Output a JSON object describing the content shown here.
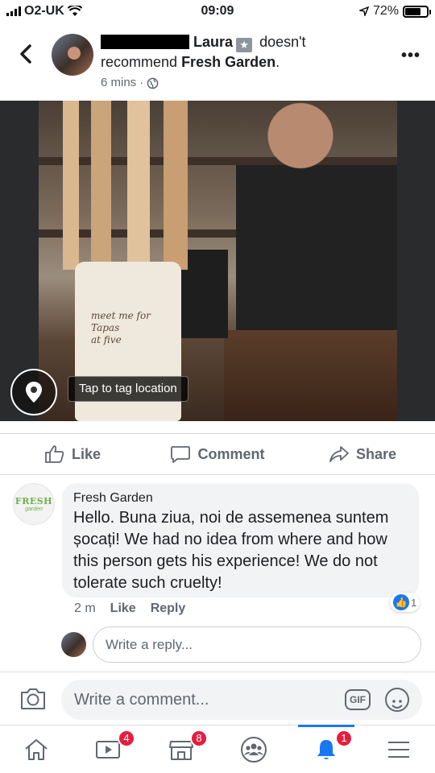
{
  "status_bar": {
    "carrier": "O2-UK",
    "time": "09:09",
    "battery": "72%",
    "battery_level": 0.72
  },
  "post": {
    "author_suffix": "Laura",
    "action_text": "doesn't",
    "recommend_text": "recommend",
    "page_name": "Fresh Garden",
    "period": ".",
    "time_ago": "6 mins",
    "separator": "·"
  },
  "photo": {
    "crock_text": "meet me for\nTapas\nat five",
    "tag_location_label": "Tap to tag location"
  },
  "actions": {
    "like": "Like",
    "comment": "Comment",
    "share": "Share"
  },
  "comment": {
    "avatar_logo": "FRESH",
    "avatar_logo_sub": "garden",
    "author": "Fresh Garden",
    "text": "Hello. Buna ziua, noi de assemenea suntem șocați! We had no idea from where and how this person gets his experience! We do not tolerate such cruelty!",
    "time": "2 m",
    "like": "Like",
    "reply": "Reply",
    "reaction_count": "1"
  },
  "reply": {
    "placeholder": "Write a reply..."
  },
  "comment_bar": {
    "placeholder": "Write a comment...",
    "gif_label": "GIF"
  },
  "tabs": {
    "watch_badge": "4",
    "marketplace_badge": "8",
    "notifications_badge": "1"
  },
  "colors": {
    "accent": "#1877f2",
    "badge": "#e41e3f",
    "brand_green": "#6eb04a"
  }
}
